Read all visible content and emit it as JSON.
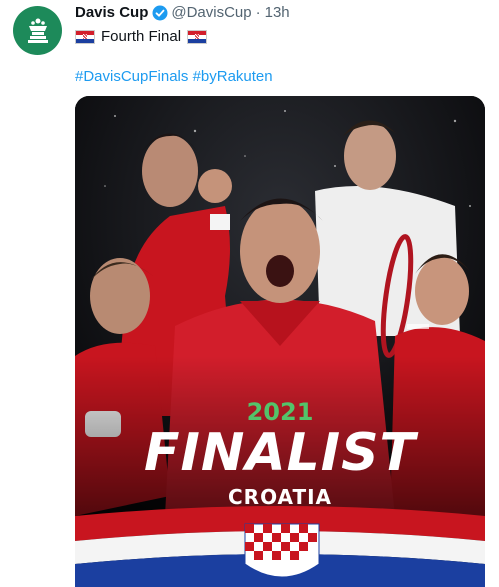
{
  "tweet": {
    "author_name": "Davis Cup",
    "handle": "@DavisCup",
    "separator": "·",
    "time": "13h",
    "text": "Fourth Final",
    "hashtags": [
      "#DavisCupFinals",
      "#byRakuten"
    ],
    "image": {
      "year": "2021",
      "headline": "FINALIST",
      "country": "CROATIA"
    }
  },
  "colors": {
    "avatar_bg": "#1d8a5a",
    "link": "#1d9bf0",
    "jersey_red": "#d21e2b",
    "year_green": "#53c36a"
  },
  "icons": [
    "davis-cup-logo-icon",
    "verified-badge-icon",
    "croatia-flag-icon"
  ]
}
